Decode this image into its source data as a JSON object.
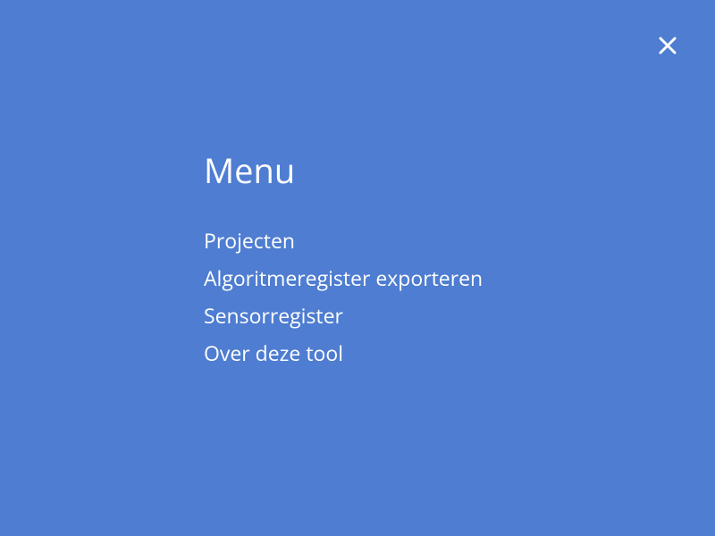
{
  "menu": {
    "title": "Menu",
    "items": [
      {
        "label": "Projecten"
      },
      {
        "label": "Algoritmeregister exporteren"
      },
      {
        "label": "Sensorregister"
      },
      {
        "label": "Over deze tool"
      }
    ]
  }
}
